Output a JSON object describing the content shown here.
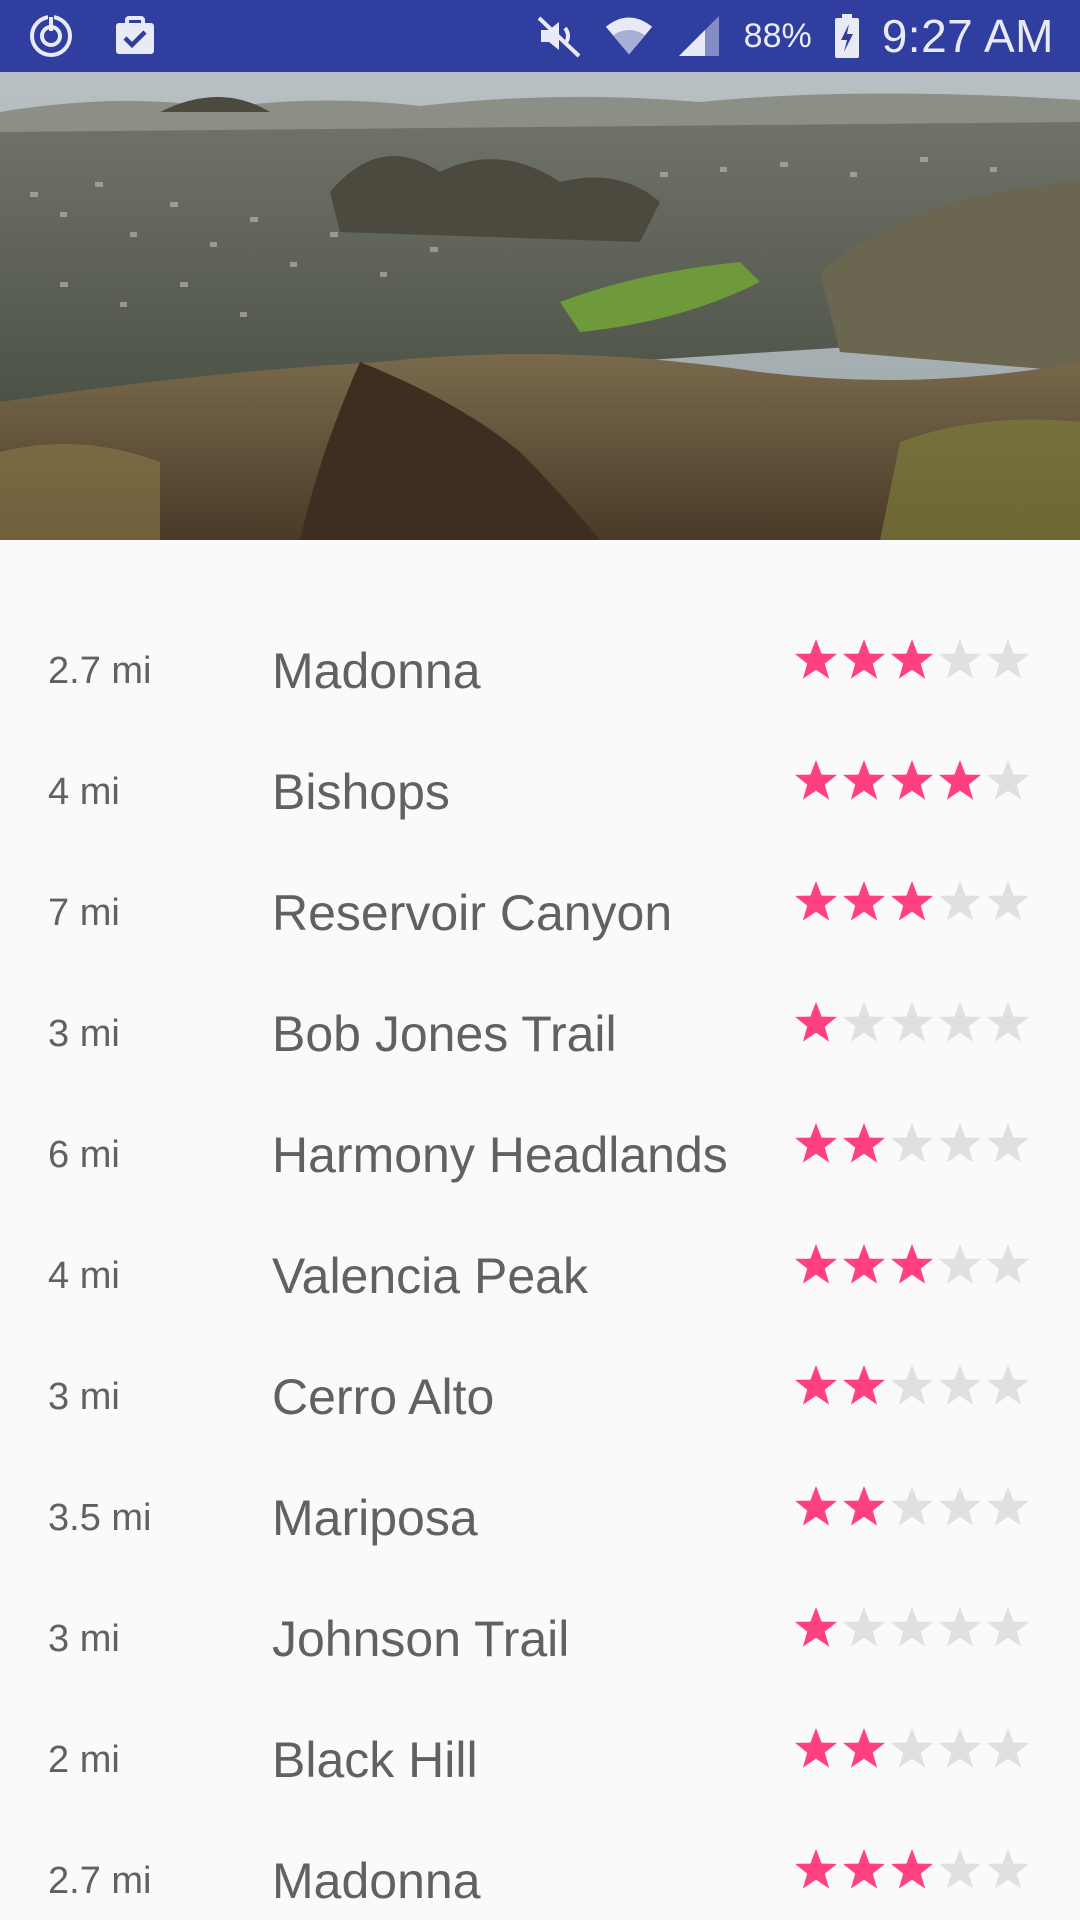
{
  "status_bar": {
    "battery": "88%",
    "time": "9:27 AM",
    "icons": [
      "sync-icon",
      "clipboard-check-icon",
      "mute-icon",
      "wifi-icon",
      "cell-signal-icon",
      "battery-charging-icon"
    ]
  },
  "header": {
    "image": "mountain-valley-town-photo"
  },
  "colors": {
    "status_bar": "#303f9f",
    "star_filled": "#ff4081",
    "star_empty": "#e0e0e0",
    "text": "#616161",
    "background": "#fafafa"
  },
  "trails": [
    {
      "distance": "2.7 mi",
      "name": "Madonna",
      "rating": 3,
      "max_rating": 5
    },
    {
      "distance": "4 mi",
      "name": "Bishops",
      "rating": 4,
      "max_rating": 5
    },
    {
      "distance": "7 mi",
      "name": "Reservoir Canyon",
      "rating": 3,
      "max_rating": 5
    },
    {
      "distance": "3 mi",
      "name": "Bob Jones Trail",
      "rating": 1,
      "max_rating": 5
    },
    {
      "distance": "6 mi",
      "name": "Harmony Headlands",
      "rating": 2,
      "max_rating": 5
    },
    {
      "distance": "4 mi",
      "name": "Valencia Peak",
      "rating": 3,
      "max_rating": 5
    },
    {
      "distance": "3 mi",
      "name": "Cerro Alto",
      "rating": 2,
      "max_rating": 5
    },
    {
      "distance": "3.5 mi",
      "name": "Mariposa",
      "rating": 2,
      "max_rating": 5
    },
    {
      "distance": "3 mi",
      "name": "Johnson Trail",
      "rating": 1,
      "max_rating": 5
    },
    {
      "distance": "2 mi",
      "name": "Black Hill",
      "rating": 2,
      "max_rating": 5
    },
    {
      "distance": "2.7 mi",
      "name": "Madonna",
      "rating": 3,
      "max_rating": 5
    }
  ]
}
